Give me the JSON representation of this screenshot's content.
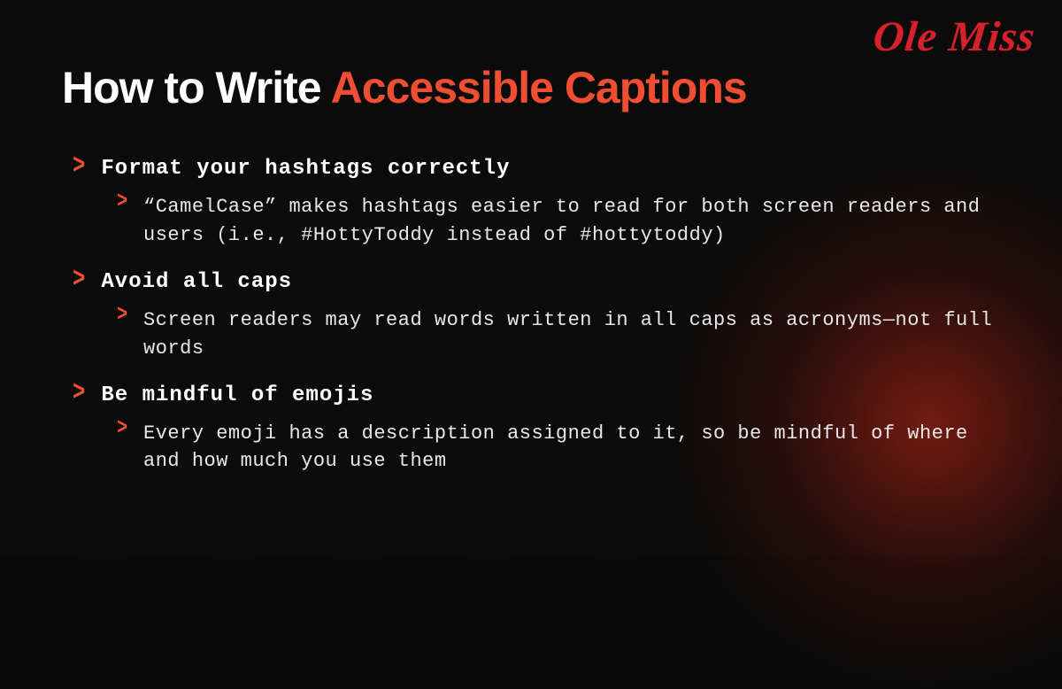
{
  "brand": "Ole Miss",
  "colors": {
    "accent": "#f04e33",
    "brand_red": "#d6202a",
    "bg": "#0a0a0a"
  },
  "title": {
    "part1": "How to Write ",
    "part2": "Accessible Captions"
  },
  "items": [
    {
      "heading": "Format your hashtags correctly",
      "detail": "“CamelCase” makes hashtags easier to read for both screen readers and users (i.e., #HottyToddy instead of #hottytoddy)"
    },
    {
      "heading": "Avoid all caps",
      "detail": "Screen readers may read words written in all caps as acronyms—not full words"
    },
    {
      "heading": "Be mindful of emojis",
      "detail": "Every emoji has a description assigned to it, so be mindful of where and how much you use them"
    }
  ]
}
